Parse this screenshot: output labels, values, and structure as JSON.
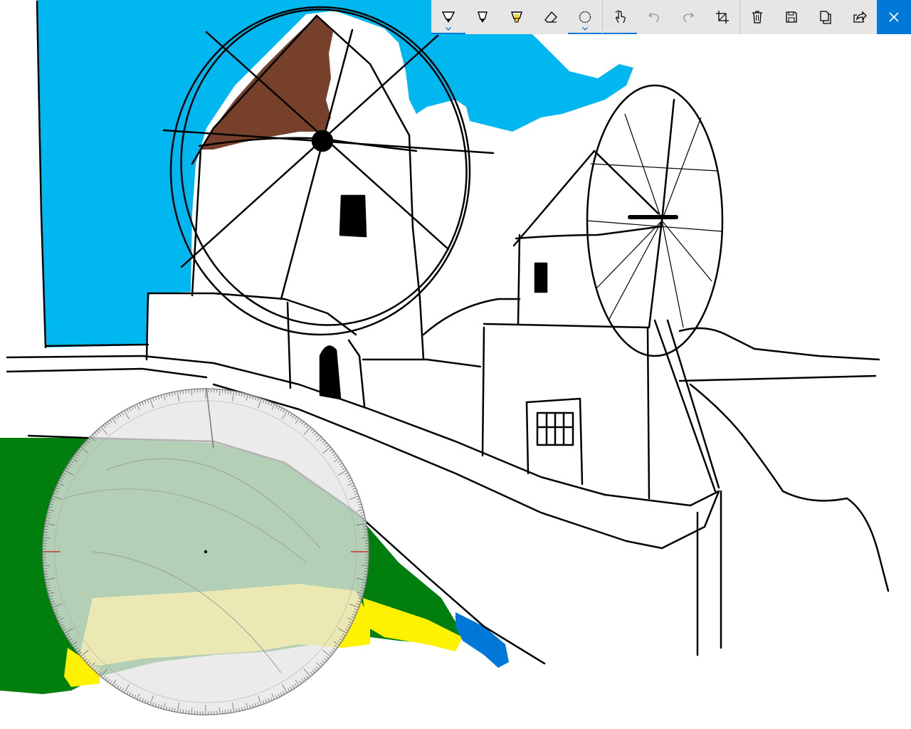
{
  "app": {
    "accent_color": "#0078d7",
    "window_title": ""
  },
  "toolbar": {
    "tools": [
      {
        "name": "ballpoint-pen",
        "icon": "ballpoint-pen-icon",
        "selected": true,
        "has_dropdown": true,
        "tip_color": "#000000"
      },
      {
        "name": "pencil",
        "icon": "pencil-icon",
        "selected": false,
        "has_dropdown": false,
        "tip_color": "#000000"
      },
      {
        "name": "highlighter",
        "icon": "highlighter-icon",
        "selected": false,
        "has_dropdown": false,
        "tip_color": "#f2d21b"
      },
      {
        "name": "eraser",
        "icon": "eraser-icon",
        "selected": false,
        "has_dropdown": false
      },
      {
        "name": "protractor",
        "icon": "protractor-icon",
        "selected": true,
        "has_dropdown": true
      }
    ],
    "actions": [
      {
        "name": "touch-writing",
        "icon": "touch-writing-icon",
        "selected": true
      },
      {
        "name": "undo",
        "icon": "undo-icon",
        "disabled": true
      },
      {
        "name": "redo",
        "icon": "redo-icon",
        "disabled": true
      },
      {
        "name": "crop",
        "icon": "crop-icon"
      }
    ],
    "file_actions": [
      {
        "name": "delete",
        "icon": "trash-icon"
      },
      {
        "name": "save",
        "icon": "save-icon"
      },
      {
        "name": "copy",
        "icon": "copy-icon"
      },
      {
        "name": "share",
        "icon": "share-icon"
      }
    ],
    "close": {
      "icon": "close-icon"
    }
  },
  "canvas": {
    "colors": {
      "sky": "#00b7ef",
      "roof": "#77402a",
      "grass": "#007f0e",
      "sand": "#fff200",
      "water": "#0078d7",
      "ink": "#000000"
    },
    "protractor": {
      "visible": true,
      "face_color": "#e6e6e6",
      "marker_color": "#c0392b"
    }
  }
}
